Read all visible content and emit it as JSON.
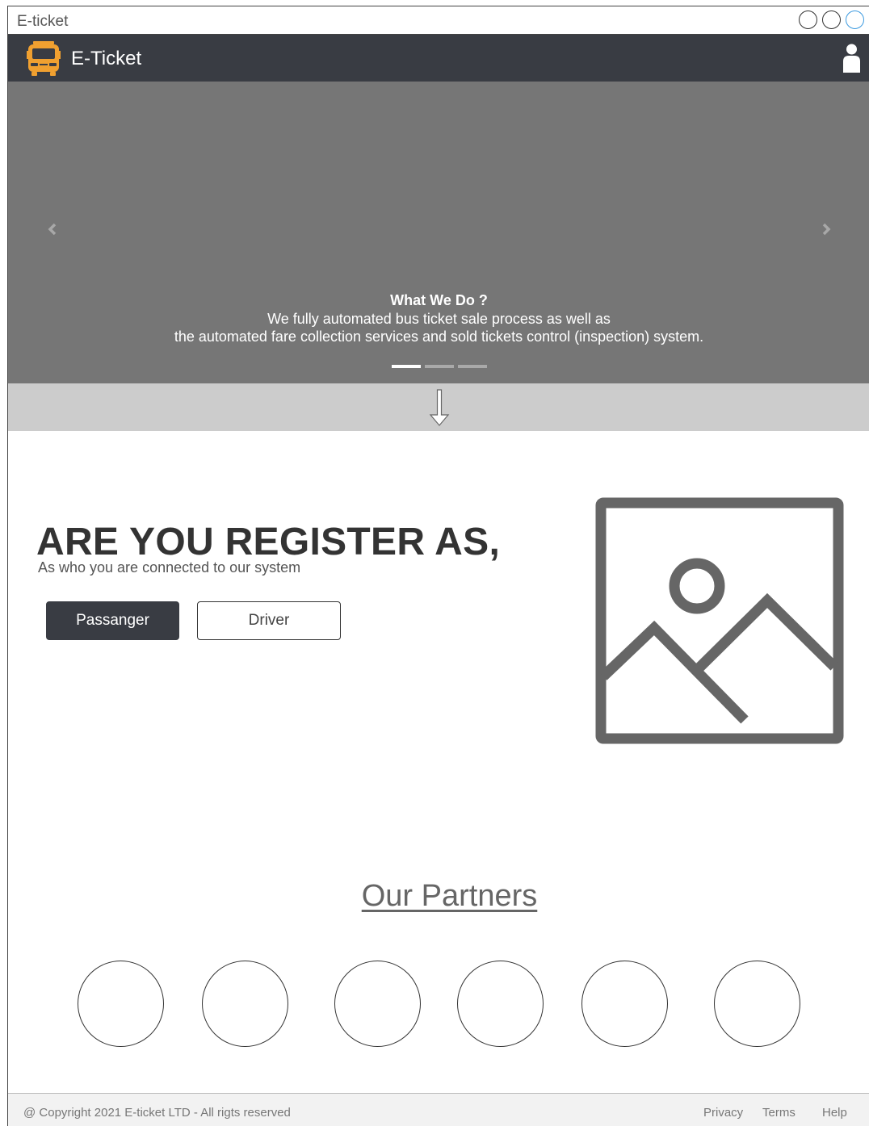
{
  "window": {
    "title": "E-ticket"
  },
  "navbar": {
    "brand": "E-Ticket",
    "brand_icon": "bus-icon",
    "user_icon": "user-icon",
    "color": "#393c43"
  },
  "carousel": {
    "heading": "What We Do ?",
    "line1": "We fully automated bus ticket sale process as well as",
    "line2": "the automated fare collection services and sold tickets control (inspection) system.",
    "slides": 3,
    "active_slide": 1
  },
  "register": {
    "title": "ARE YOU REGISTER AS,",
    "subtitle": "As who you are connected to our system",
    "passenger_label": "Passanger",
    "driver_label": "Driver",
    "image_icon": "image-placeholder-icon"
  },
  "partners": {
    "title": "Our Partners",
    "count": 6
  },
  "footer": {
    "copyright": "@ Copyright 2021 E-ticket LTD - All rigts reserved",
    "links": [
      "Privacy",
      "Terms",
      "Help"
    ]
  },
  "colors": {
    "accent": "#393c43",
    "bus_orange": "#f0a030",
    "window_control_active": "#3d9be0"
  }
}
